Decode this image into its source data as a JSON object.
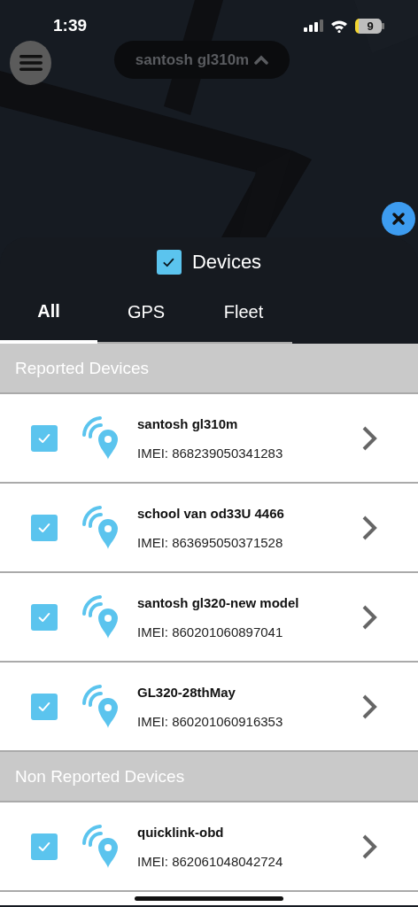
{
  "status_bar": {
    "time": "1:39",
    "battery": "9"
  },
  "map": {
    "kind": "picture",
    "device_selector": "santosh gl310m"
  },
  "sheet": {
    "title": "Devices",
    "checked": true
  },
  "tabs": [
    {
      "label": "All",
      "selected": true
    },
    {
      "label": "GPS",
      "selected": false
    },
    {
      "label": "Fleet",
      "selected": false
    }
  ],
  "sections": [
    {
      "title": "Reported Devices",
      "devices": [
        {
          "name": "santosh gl310m",
          "imei": "IMEI: 868239050341283",
          "checked": true
        },
        {
          "name": "school van od33U 4466",
          "imei": "IMEI: 863695050371528",
          "checked": true
        },
        {
          "name": "santosh gl320-new model",
          "imei": "IMEI: 860201060897041",
          "checked": true
        },
        {
          "name": "GL320-28thMay",
          "imei": "IMEI: 860201060916353",
          "checked": true
        }
      ]
    },
    {
      "title": "Non Reported Devices",
      "devices": [
        {
          "name": "quicklink-obd",
          "imei": "IMEI: 862061048042724",
          "checked": true
        }
      ]
    }
  ]
}
